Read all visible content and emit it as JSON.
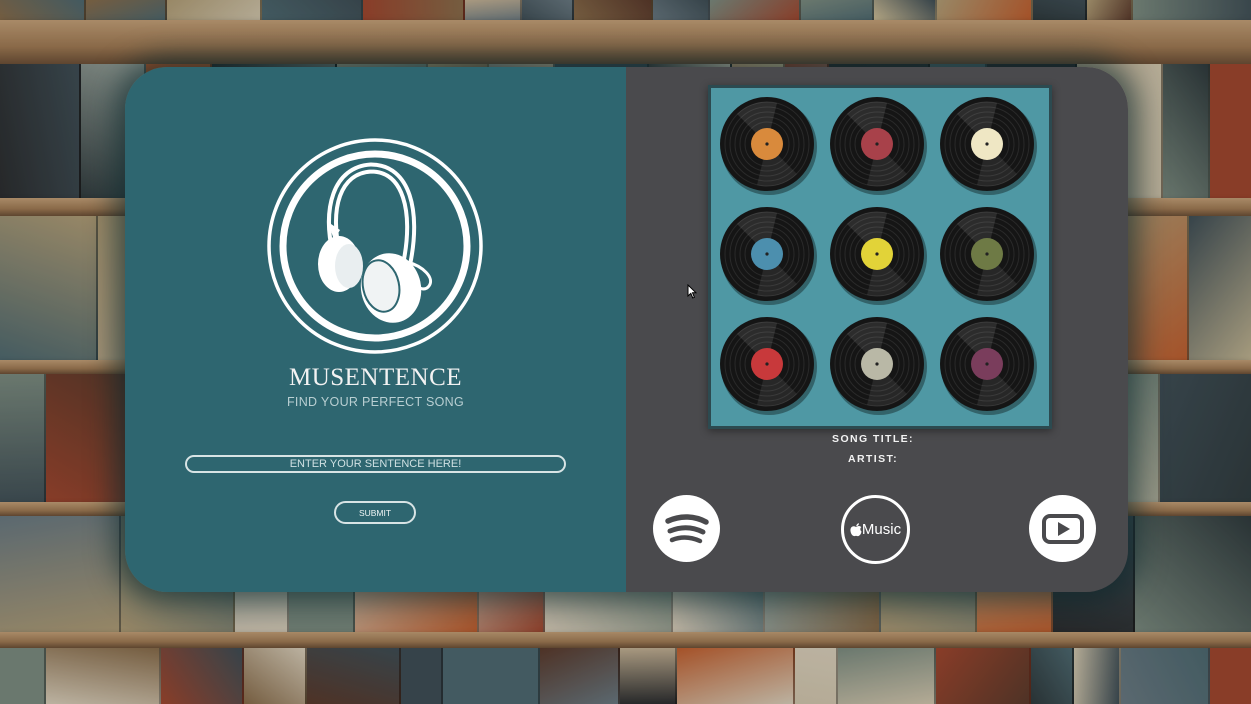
{
  "brand": {
    "name": "MUSENTENCE",
    "tagline": "FIND YOUR PERFECT SONG"
  },
  "search": {
    "placeholder": "ENTER YOUR SENTENCE HERE!",
    "value": ""
  },
  "submit": {
    "label": "SUBMIT"
  },
  "result": {
    "song_title_label": "SONG TITLE:",
    "song_title_value": "",
    "artist_label": "ARTIST:",
    "artist_value": ""
  },
  "services": [
    {
      "name": "spotify",
      "icon": "spotify-icon"
    },
    {
      "name": "apple-music",
      "icon": "apple-music-icon",
      "label": "Music"
    },
    {
      "name": "youtube",
      "icon": "youtube-icon"
    }
  ],
  "album_art": {
    "background": "#4f98a4",
    "record_label_colors": [
      "#d98a3c",
      "#a8414a",
      "#efe7c4",
      "#4c8fae",
      "#e2d338",
      "#6e7a45",
      "#c8393b",
      "#b9b8a6",
      "#7a3d5c"
    ]
  },
  "colors": {
    "left_panel": "#2e6670",
    "right_panel": "#4a4a4d",
    "text": "#f2f2f2"
  }
}
